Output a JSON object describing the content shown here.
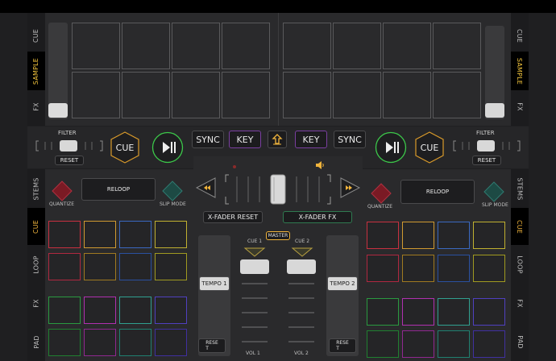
{
  "left_tabs_top": [
    "CUE",
    "SAMPLE",
    "FX"
  ],
  "right_tabs_top": [
    "CUE",
    "SAMPLE",
    "FX"
  ],
  "left_tabs_bottom": [
    "STEMS",
    "CUE",
    "LOOP",
    "FX",
    "PAD"
  ],
  "right_tabs_bottom": [
    "STEMS",
    "CUE",
    "LOOP",
    "FX",
    "PAD"
  ],
  "deck_left": {
    "filter_label": "FILTER",
    "reset_label": "RESET",
    "cue_label": "CUE",
    "play_icon": "play-pause-icon",
    "quantize_label": "QUANTIZE",
    "reloop_label": "RELOOP",
    "slip_label": "SLIP MODE",
    "tempo_label": "TEMPO 1",
    "tempo_reset": "RESE\nT"
  },
  "deck_right": {
    "filter_label": "FILTER",
    "reset_label": "RESET",
    "cue_label": "CUE",
    "play_icon": "play-pause-icon",
    "quantize_label": "QUANTIZE",
    "reloop_label": "RELOOP",
    "slip_label": "SLIP MODE",
    "tempo_label": "TEMPO 2",
    "tempo_reset": "RESE\nT"
  },
  "center": {
    "sync_left": "SYNC",
    "key_left": "KEY",
    "sync_right": "SYNC",
    "key_right": "KEY",
    "xfader_reset": "X-FADER RESET",
    "xfader_fx": "X-FADER FX",
    "master": "MASTER",
    "cue1": "CUE 1",
    "cue2": "CUE 2",
    "vol1": "VOL 1",
    "vol2": "VOL 2"
  },
  "colors": {
    "accent": "#f0b43c",
    "play_ring": "#3cc84a",
    "cue_hex": "#d99a2a",
    "key_border": "#7a3fa0",
    "quantize": "#8a1f2a",
    "slip": "#1f5a52"
  }
}
